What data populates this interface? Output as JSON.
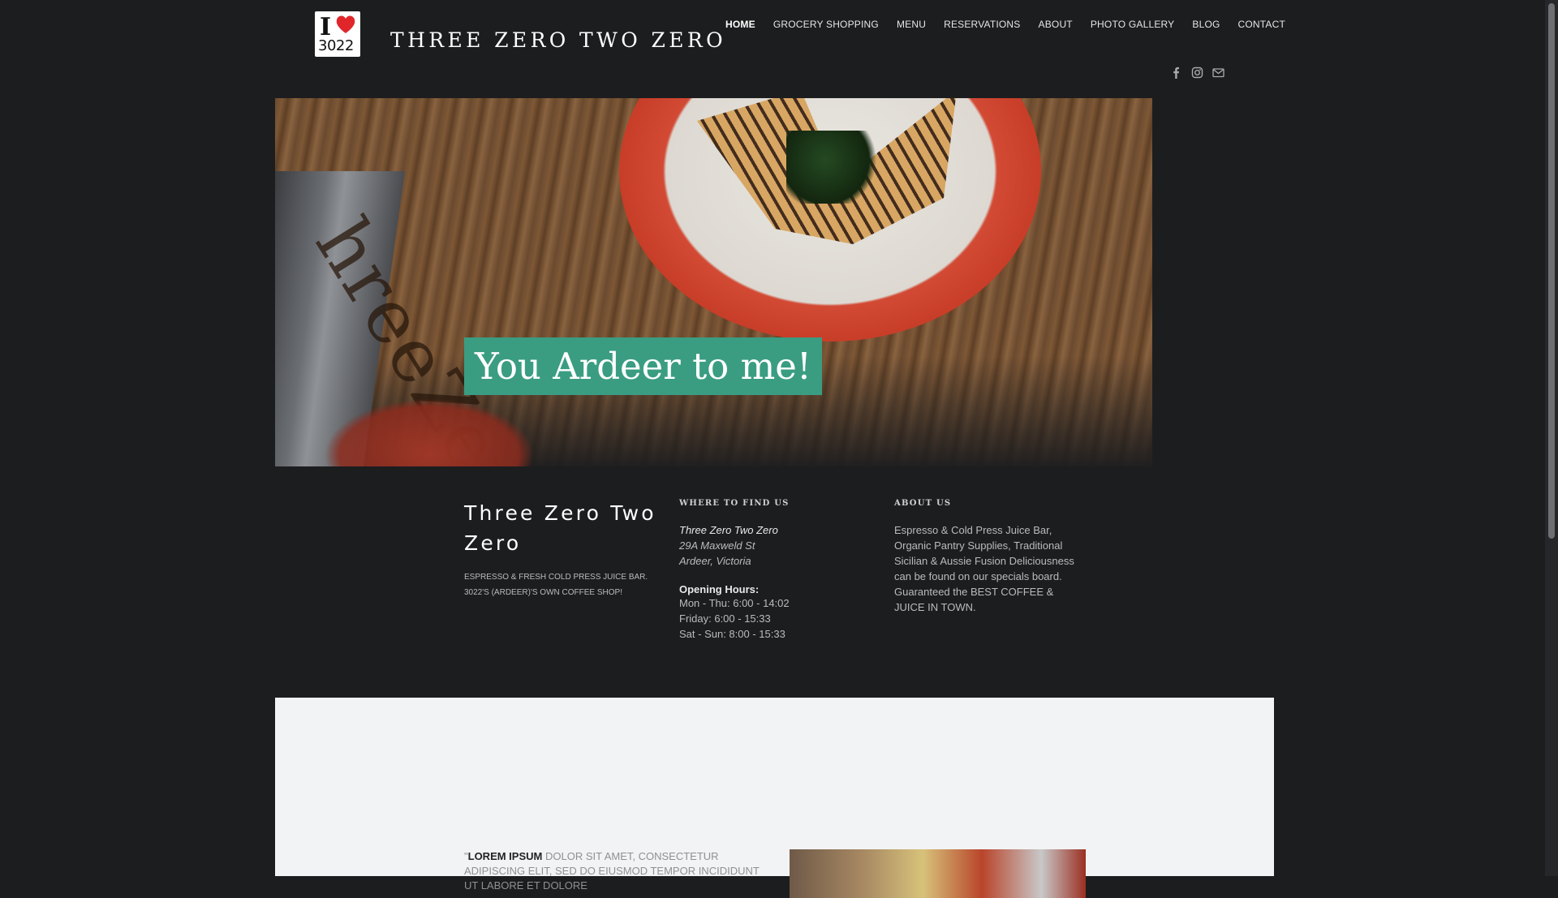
{
  "header": {
    "logo_text_line1": "I",
    "logo_text_line2": "3022",
    "site_title": "THREE ZERO TWO ZERO"
  },
  "nav": [
    {
      "label": "HOME",
      "active": true
    },
    {
      "label": "GROCERY SHOPPING",
      "active": false
    },
    {
      "label": "MENU",
      "active": false
    },
    {
      "label": "RESERVATIONS",
      "active": false
    },
    {
      "label": "ABOUT",
      "active": false
    },
    {
      "label": "PHOTO GALLERY",
      "active": false
    },
    {
      "label": "BLOG",
      "active": false
    },
    {
      "label": "CONTACT",
      "active": false
    }
  ],
  "social_icons": [
    "facebook-icon",
    "instagram-icon",
    "mail-icon"
  ],
  "hero": {
    "board_text": "hreeZero",
    "tagline": "You Ardeer to me!"
  },
  "brand": {
    "name": "Three Zero Two Zero",
    "description": "ESPRESSO & FRESH COLD PRESS JUICE BAR. 3022'S (ARDEER)'S OWN COFFEE SHOP!"
  },
  "find_us": {
    "heading": "WHERE TO FIND US",
    "business": "Three Zero Two Zero",
    "street": "29A Maxweld St",
    "locality": "Ardeer, Victoria",
    "hours_heading": "Opening Hours:",
    "hours": [
      "Mon - Thu: 6:00 - 14:02",
      "Friday: 6:00 - 15:33",
      "Sat - Sun: 8:00 - 15:33"
    ]
  },
  "about": {
    "heading": "ABOUT US",
    "body": "Espresso & Cold Press Juice Bar, Organic Pantry Supplies, Traditional Sicilian & Aussie Fusion Deliciousness can be found on our specials board. Guaranteed the BEST COFFEE & JUICE IN TOWN."
  },
  "lower": {
    "quote_open": "\"",
    "lorem_bold": "LOREM IPSUM",
    "lorem_rest": " DOLOR SIT AMET, CONSECTETUR ADIPISCING ELIT, SED DO EIUSMOD TEMPOR INCIDIDUNT UT LABORE ET DOLORE"
  },
  "colors": {
    "page_bg": "#1c1d1f",
    "accent_teal": "#3a9d82",
    "light_section_bg": "#f2f3f5",
    "logo_heart": "#e0262b"
  }
}
